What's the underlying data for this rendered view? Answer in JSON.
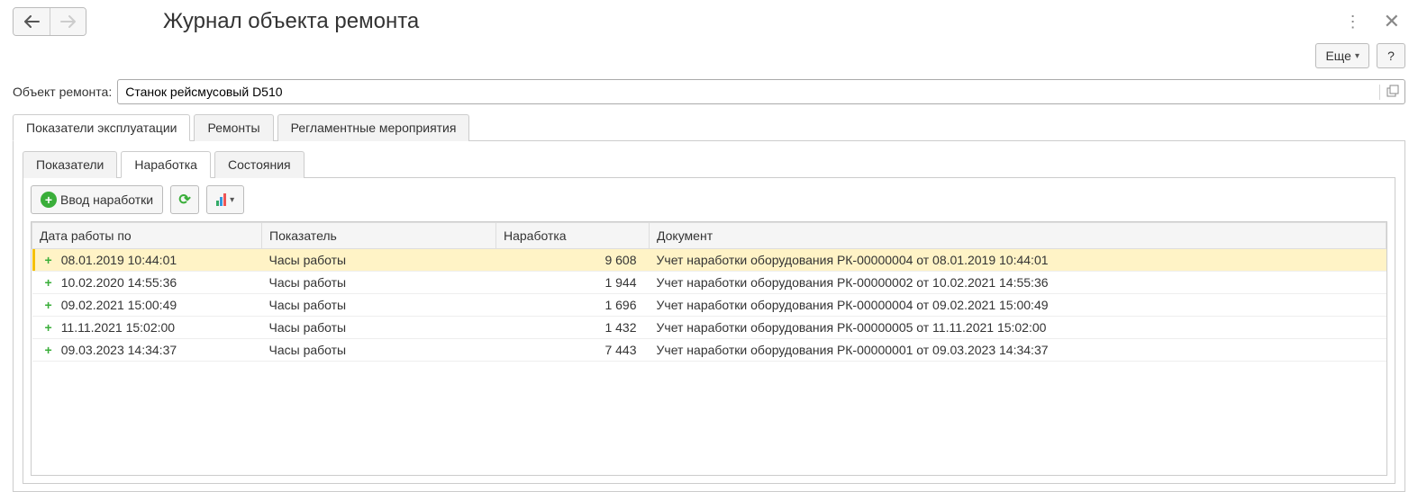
{
  "header": {
    "title": "Журнал объекта ремонта"
  },
  "toolbar": {
    "more_label": "Еще",
    "help_label": "?"
  },
  "field": {
    "label": "Объект ремонта:",
    "value": "Станок рейсмусовый D510"
  },
  "tabs_main": [
    {
      "label": "Показатели эксплуатации",
      "active": true
    },
    {
      "label": "Ремонты",
      "active": false
    },
    {
      "label": "Регламентные мероприятия",
      "active": false
    }
  ],
  "tabs_inner": [
    {
      "label": "Показатели",
      "active": false
    },
    {
      "label": "Наработка",
      "active": true
    },
    {
      "label": "Состояния",
      "active": false
    }
  ],
  "actions": {
    "add_label": "Ввод наработки"
  },
  "grid": {
    "columns": [
      "Дата работы по",
      "Показатель",
      "Наработка",
      "Документ"
    ],
    "rows": [
      {
        "date": "08.01.2019 10:44:01",
        "indicator": "Часы работы",
        "value": "9 608",
        "doc": "Учет наработки оборудования РК-00000004 от 08.01.2019 10:44:01",
        "selected": true
      },
      {
        "date": "10.02.2020 14:55:36",
        "indicator": "Часы работы",
        "value": "1 944",
        "doc": "Учет наработки оборудования РК-00000002 от 10.02.2021 14:55:36",
        "selected": false
      },
      {
        "date": "09.02.2021 15:00:49",
        "indicator": "Часы работы",
        "value": "1 696",
        "doc": "Учет наработки оборудования РК-00000004 от 09.02.2021 15:00:49",
        "selected": false
      },
      {
        "date": "11.11.2021 15:02:00",
        "indicator": "Часы работы",
        "value": "1 432",
        "doc": "Учет наработки оборудования РК-00000005 от 11.11.2021 15:02:00",
        "selected": false
      },
      {
        "date": "09.03.2023 14:34:37",
        "indicator": "Часы работы",
        "value": "7 443",
        "doc": "Учет наработки оборудования РК-00000001 от 09.03.2023 14:34:37",
        "selected": false
      }
    ]
  }
}
